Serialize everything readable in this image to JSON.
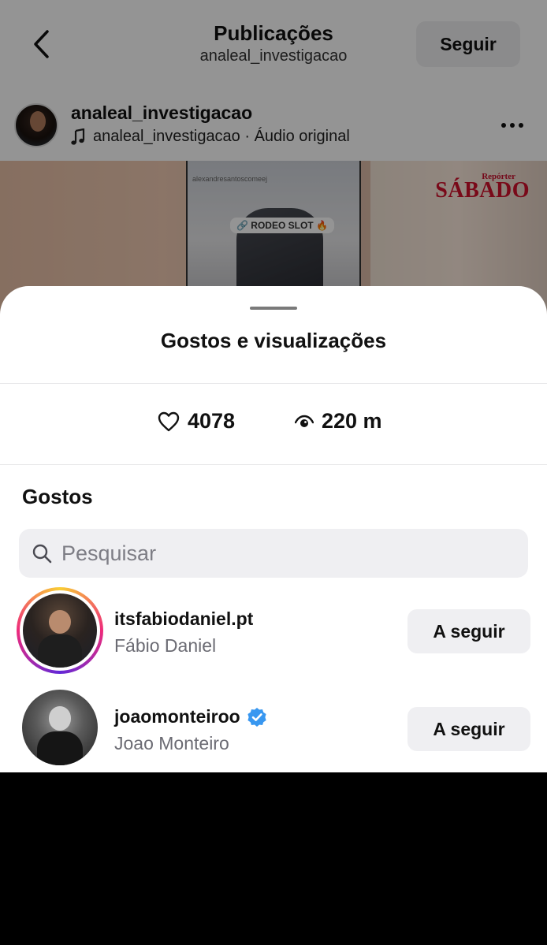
{
  "header": {
    "title": "Publicações",
    "subtitle": "analeal_investigacao",
    "follow_label": "Seguir"
  },
  "post": {
    "username": "analeal_investigacao",
    "audio_user": "analeal_investigacao",
    "audio_separator": " · ",
    "audio_label": "Áudio original"
  },
  "media": {
    "story_user": "alexandresantoscomeej",
    "story_tag": "🔗 RODEO SLOT 🔥",
    "brand_small": "Repórter",
    "brand": "SÁBADO"
  },
  "sheet": {
    "title": "Gostos e visualizações",
    "likes_count": "4078",
    "views_count": "220 m",
    "section_title": "Gostos",
    "search_placeholder": "Pesquisar",
    "users": [
      {
        "handle": "itsfabiodaniel.pt",
        "name": "Fábio Daniel",
        "button": "A seguir",
        "verified": false,
        "story_ring": true
      },
      {
        "handle": "joaomonteiroo",
        "name": "Joao Monteiro",
        "button": "A seguir",
        "verified": true,
        "story_ring": false
      }
    ]
  },
  "colors": {
    "verified_badge": "#3897f0",
    "button_bg": "#efeff2",
    "secondary_text": "#6b6b73"
  }
}
